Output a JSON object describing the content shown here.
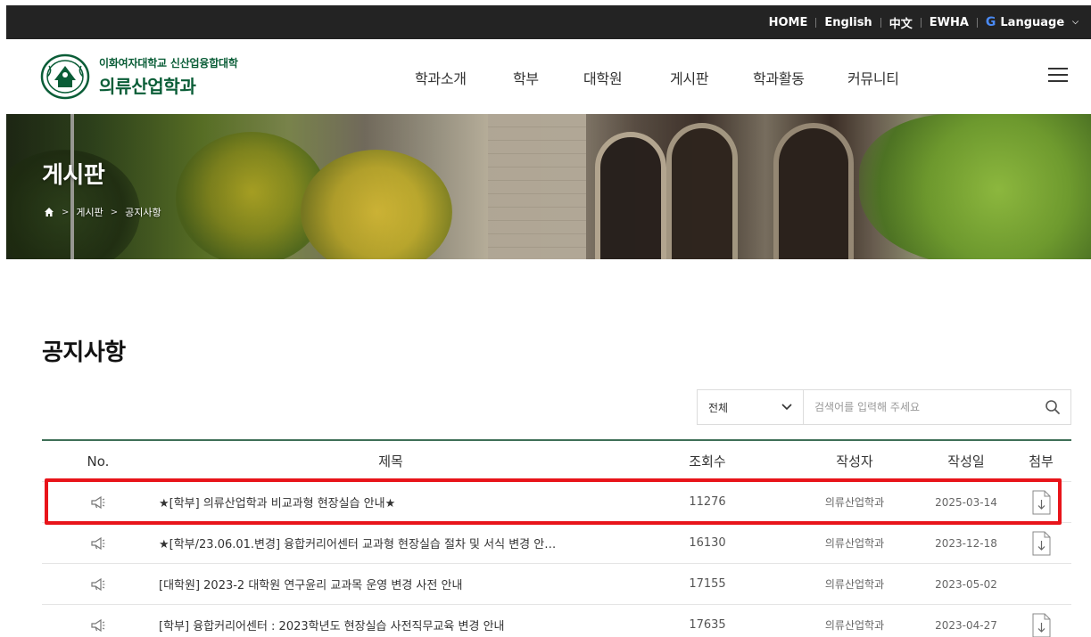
{
  "topnav": {
    "home": "HOME",
    "english": "English",
    "chinese": "中文",
    "ewha": "EWHA",
    "language": "Language",
    "language_icon": "G"
  },
  "logo": {
    "subtitle": "이화여자대학교 신산업융합대학",
    "title": "의류산업학과"
  },
  "gnb": [
    "학과소개",
    "학부",
    "대학원",
    "게시판",
    "학과활동",
    "커뮤니티"
  ],
  "banner": {
    "title": "게시판",
    "breadcrumb": [
      "게시판",
      "공지사항"
    ]
  },
  "page_title": "공지사항",
  "search": {
    "filter_value": "전체",
    "placeholder": "검색어를 입력해 주세요"
  },
  "table": {
    "headers": {
      "no": "No.",
      "title": "제목",
      "views": "조회수",
      "author": "작성자",
      "date": "작성일",
      "file": "첨부"
    },
    "rows": [
      {
        "title": "★[학부] 의류산업학과 비교과형 현장실습 안내★",
        "views": "11276",
        "author": "의류산업학과",
        "date": "2025-03-14",
        "attachment": true
      },
      {
        "title": "★[학부/23.06.01.변경] 융합커리어센터 교과형 현장실습 절차 및 서식 변경 안…",
        "views": "16130",
        "author": "의류산업학과",
        "date": "2023-12-18",
        "attachment": true
      },
      {
        "title": "[대학원] 2023-2 대학원 연구윤리 교과목 운영 변경 사전 안내",
        "views": "17155",
        "author": "의류산업학과",
        "date": "2023-05-02",
        "attachment": false
      },
      {
        "title": "[학부] 융합커리어센터 : 2023학년도 현장실습 사전직무교육 변경 안내",
        "views": "17635",
        "author": "의류산업학과",
        "date": "2023-04-27",
        "attachment": true
      }
    ]
  },
  "colors": {
    "brand_green": "#0a5d37",
    "board_line": "#3f6f57",
    "highlight": "#e8141a",
    "topbar": "#232323"
  }
}
